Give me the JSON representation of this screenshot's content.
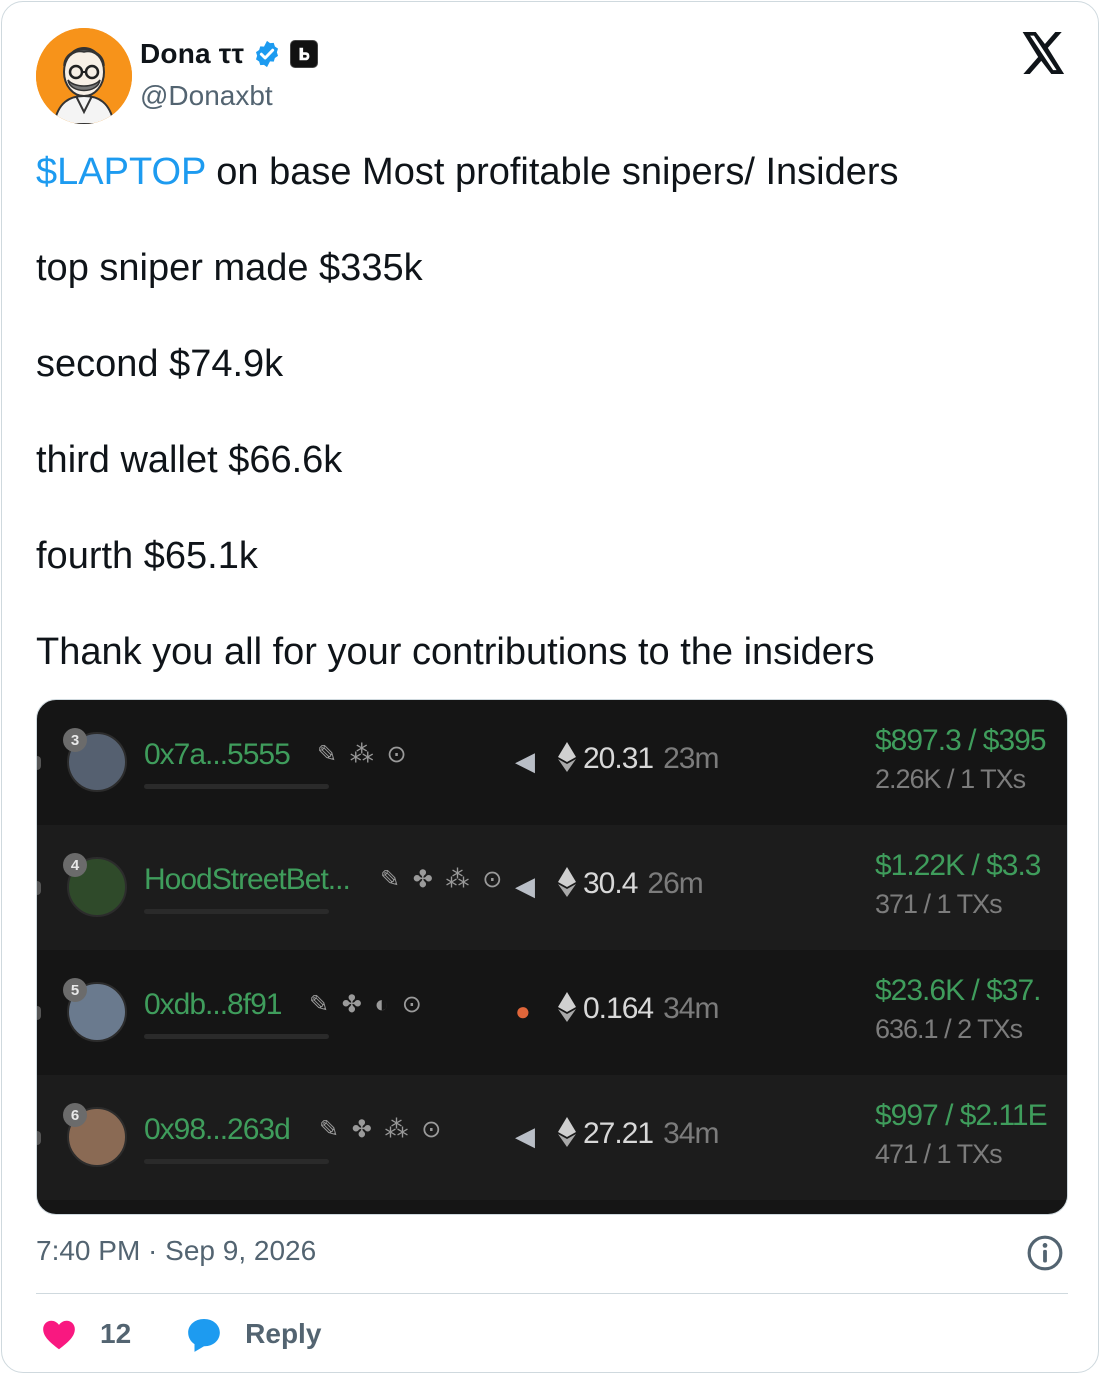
{
  "author": {
    "display_name": "Dona ττ",
    "handle": "@Donaxbt",
    "verified": true,
    "avatar_color": "#f7931a"
  },
  "platform_icon": "x-logo-icon",
  "tweet": {
    "cashtag": "$LAPTOP",
    "line1_rest": " on base Most profitable snipers/ Insiders",
    "line2": "top sniper made $335k",
    "line3": "second $74.9k",
    "line4": "third wallet $66.6k",
    "line5": "fourth $65.1k",
    "line6": "Thank you all for your contributions to the insiders"
  },
  "media": {
    "rows": [
      {
        "rank": "3",
        "wallet": "0x7a...5555",
        "icons": "✎ ⁂ ⊙",
        "amount": "20.31",
        "elapsed": "23m",
        "pnl": "$897.3 / $395",
        "txs": "2.26K / 1 TXs"
      },
      {
        "rank": "4",
        "wallet": "HoodStreetBet...",
        "icons": "✎ ✤ ⁂ ⊙",
        "amount": "30.4",
        "elapsed": "26m",
        "pnl": "$1.22K / $3.3",
        "txs": "371 / 1 TXs"
      },
      {
        "rank": "5",
        "wallet": "0xdb...8f91",
        "icons": "✎ ✤ ◐ ⊙",
        "amount": "0.164",
        "elapsed": "34m",
        "pnl": "$23.6K / $37.",
        "txs": "636.1 / 2 TXs"
      },
      {
        "rank": "6",
        "wallet": "0x98...263d",
        "icons": "✎ ✤ ⁂ ⊙",
        "amount": "27.21",
        "elapsed": "34m",
        "pnl": "$997 / $2.11E",
        "txs": "471 / 1 TXs"
      }
    ]
  },
  "footer": {
    "timestamp": "7:40 PM · Sep 9, 2026",
    "like_count": "12",
    "reply_label": "Reply"
  },
  "colors": {
    "link": "#1d9bf0",
    "like": "#f91880",
    "reply": "#1d9bf0",
    "wallet_green": "#3f9d5c"
  }
}
